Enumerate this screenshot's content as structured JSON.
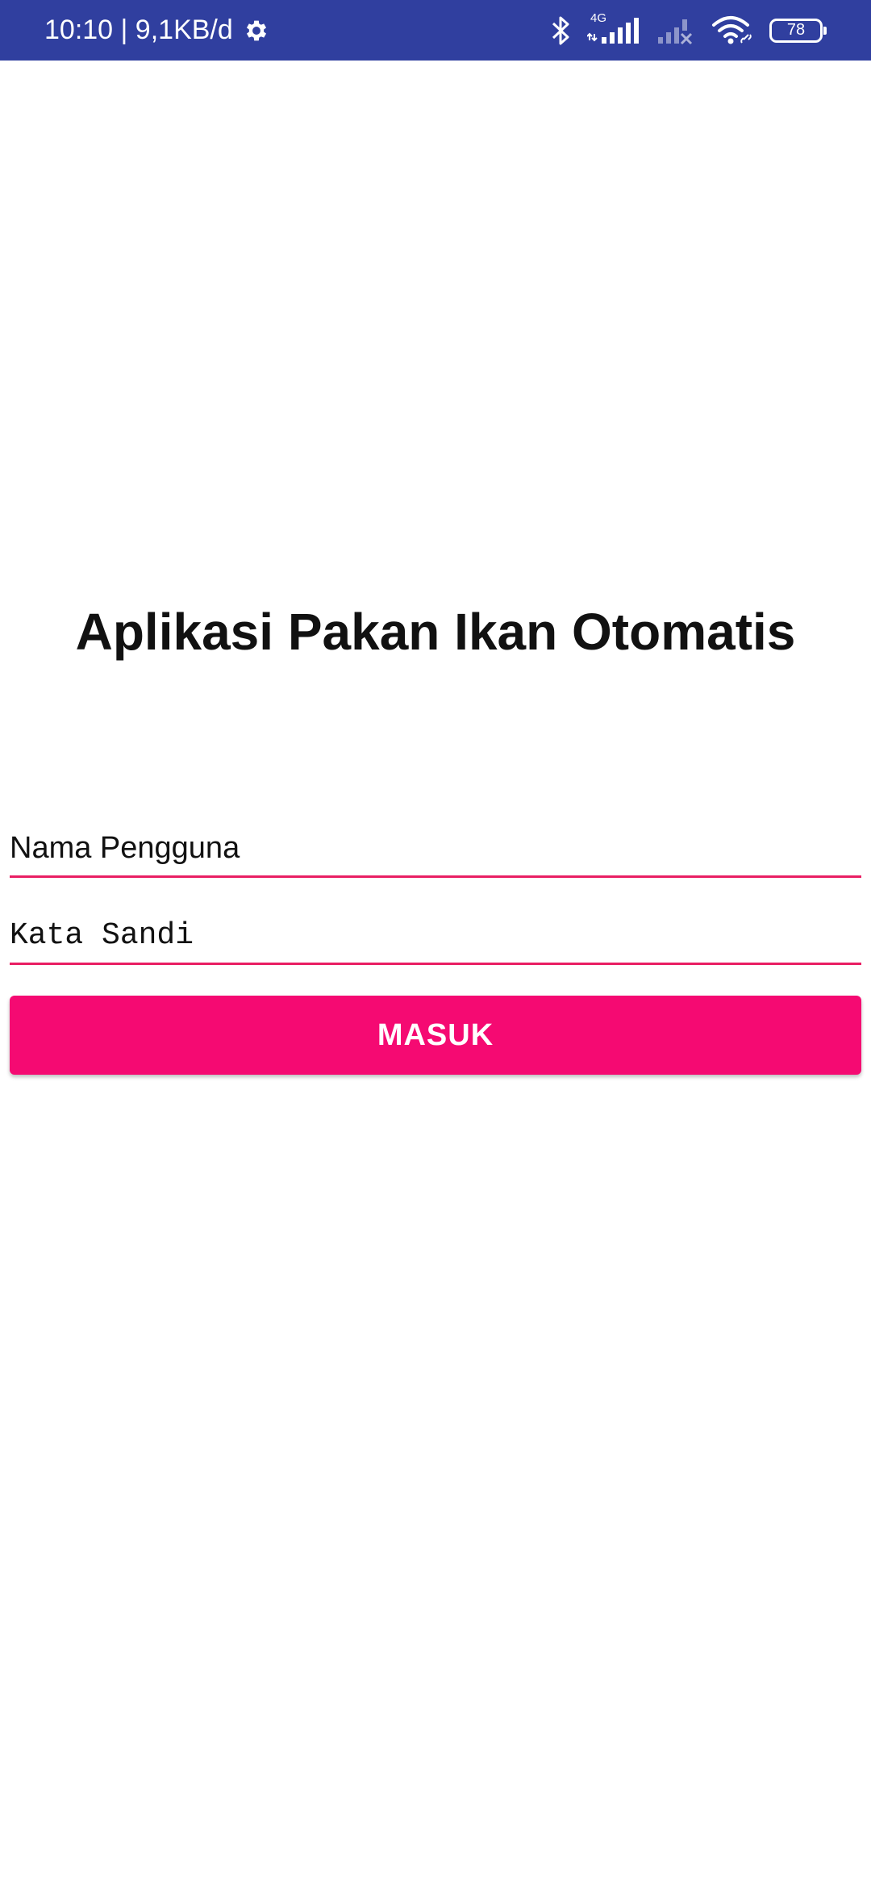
{
  "status_bar": {
    "time_speed": "10:10 | 9,1KB/d",
    "network_type": "4G",
    "battery_level": "78",
    "icons": [
      "gear-icon",
      "bluetooth-icon",
      "signal-icon",
      "signal-no-service-icon",
      "wifi-icon",
      "battery-icon"
    ],
    "background_color": "#303f9f"
  },
  "login": {
    "title": "Aplikasi Pakan Ikan Otomatis",
    "username_placeholder": "Nama Pengguna",
    "password_placeholder": "Kata Sandi",
    "submit_label": "MASUK",
    "accent_color": "#e91e63",
    "button_color": "#f50a72"
  }
}
